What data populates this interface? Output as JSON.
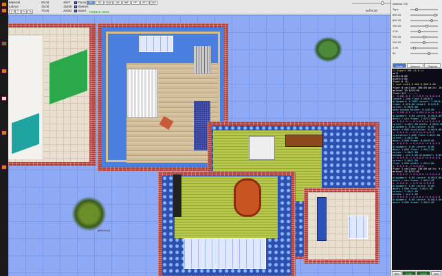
{
  "toolbar": {
    "row1": [
      {
        "k": "Material",
        "v": "55.00"
      },
      {
        "k": "",
        "v": "4607"
      }
    ],
    "row2": [
      {
        "k": "Labour",
        "v": "15.00"
      },
      {
        "k": "",
        "v": "15485"
      }
    ],
    "row3": [
      {
        "k": "Total",
        "v": "70.00"
      },
      {
        "k": "",
        "v": "20092"
      }
    ],
    "checkboxes": [
      "Floors",
      "Gleams",
      "Stand"
    ],
    "tool_tabs": [
      "2D",
      "3D",
      "SUB",
      "AB",
      "IBP",
      "PP",
      "JPT",
      "DXF"
    ],
    "green_status": "HB1916 US23",
    "left_buttons": [
      "0",
      "T",
      "Fx",
      "Ts",
      "Fd",
      "Ld",
      "Xs",
      "Fm"
    ],
    "right_readout": "self 8.00"
  },
  "right_panel": {
    "rows": [
      {
        "label": "Material",
        "value": "700"
      },
      {
        "label": "Type",
        "value": "",
        "pos": 0.2
      },
      {
        "label": "",
        "value": "800.00",
        "pos": 0.95
      },
      {
        "label": "",
        "value": "800.00",
        "pos": 0.8
      },
      {
        "label": "",
        "value": "100.00",
        "pos": 0.6
      },
      {
        "label": "",
        "value": "1.00",
        "pos": 0.3
      },
      {
        "label": "",
        "value": "200.00",
        "pos": 0.5
      },
      {
        "label": "",
        "value": "200.00",
        "pos": 0.5
      },
      {
        "label": "",
        "value": "2.00",
        "pos": 0.1
      },
      {
        "label": "",
        "value": "90",
        "pos": 0.7
      }
    ],
    "tabs": [
      "Code",
      "Artwork",
      "Objects"
    ],
    "console": [
      {
        "t": "== Export XML v4.0 ==",
        "c": "#ffe066"
      },
      {
        "t": "wall",
        "c": "#ffffff"
      },
      {
        "t": "width:0.00",
        "c": "#ffffff"
      },
      {
        "t": "width:2.00",
        "c": "#ffffff"
      },
      {
        "t": "floor 0 (1)",
        "c": "#ffffff"
      },
      {
        "t": "1 roof  width 0.000 0.000 0.00",
        "c": "#ffe066"
      },
      {
        "t": "floor 0 ceiling: 300.00  walls: 10.0/10",
        "c": "#ffffff"
      },
      {
        "t": "method: 20.0/20.00",
        "c": "#ffffff"
      },
      {
        "t": "floor:1/2 -------",
        "c": "#ffffff"
      },
      {
        "t": "  x: 0.041,0.0 -> 2,0.0 to 0.0,0.0",
        "c": "#ff7dff"
      },
      {
        "t": "  length 1.200  floor 0.00/0.0",
        "c": "#7df0ff"
      },
      {
        "t": "  alignment: 0.2807  corner: 1.00/0.00",
        "c": "#7df0ff"
      },
      {
        "t": "  frame: 0.0/0.00  height: 0.0/0.0",
        "c": "#7df0ff"
      },
      {
        "t": "  corner: 0.00/0.00",
        "c": "#7df0ff"
      },
      {
        "t": "  open  window  height: 0.0/0.00",
        "c": "#7df0ff"
      },
      {
        "t": "  x: 0.030,0.0 -> 0.030,0.0 to 0.0,0.0",
        "c": "#ff7dff"
      },
      {
        "t": "  alignment: 0.00  corner: 0.00/0.00",
        "c": "#7df0ff"
      },
      {
        "t": "  doors / win  frame: 1.02/1.000",
        "c": "#7df0ff"
      },
      {
        "t": "  x: 0.0,0.0 -> 0.0,0.0 to 0.0,0.0",
        "c": "#ff7dff"
      },
      {
        "t": "  corner: 1.00/1.00  width: 0.00/0.00",
        "c": "#7df0ff"
      },
      {
        "t": "  alignment: 0.00  corner: 0.00",
        "c": "#7df0ff"
      },
      {
        "t": "  doors 1.000  insulation: 0.00/0.00",
        "c": "#7df0ff"
      },
      {
        "t": "  x: 0.0,0.0 -> 0.0 to 0.0,0.0",
        "c": "#ff7dff"
      },
      {
        "t": "  insulation  1.000  floor  1.00/1.00",
        "c": "#7df0ff"
      },
      {
        "t": "  corner: 1.00/1.00",
        "c": "#7df0ff"
      },
      {
        "t": "  doors 1.000  frame: 0.00/0.00",
        "c": "#7df0ff"
      },
      {
        "t": "  x: 0.0,0.0 -> 0.0,0.0 to 0.0,0.0",
        "c": "#ff7dff"
      },
      {
        "t": "  alignment: 0.00  corner: 0.00",
        "c": "#7df0ff"
      },
      {
        "t": "  doors 1.000  floor: 1.00/1.00",
        "c": "#7df0ff"
      },
      {
        "t": "  corner: 1.00/1.00",
        "c": "#7df0ff"
      },
      {
        "t": "  window / win  0.00  alignment: 0.00",
        "c": "#7df0ff"
      },
      {
        "t": "  x: 0.0,0.0 -> 0.0,0.0 to 0.0,0.0",
        "c": "#ff7dff"
      },
      {
        "t": "  corner: 1.00/1.00",
        "c": "#7df0ff"
      },
      {
        "t": "  floor 1.000  width: 1.00/1.00",
        "c": "#7df0ff"
      },
      {
        "t": "  x: 0.0,0.0 -> 0.0,0.0",
        "c": "#ff7dff"
      },
      {
        "t": "floor 1 ceiling: 250.00  walls: 5.0/25",
        "c": "#ffffff"
      },
      {
        "t": "method: 25.0/25.00",
        "c": "#ffffff"
      },
      {
        "t": "  x: 0.0,0.0 -> 0.0,0.0 to 0.0,0.0",
        "c": "#ff7dff"
      },
      {
        "t": "  alignment: 0.00  corner: 0.00/0.00",
        "c": "#7df0ff"
      },
      {
        "t": "  doors / win  frame: 1.00/1.00",
        "c": "#7df0ff"
      },
      {
        "t": "  x: 0.0,0.0 -> 0.0 to 0.0,0.0",
        "c": "#ff7dff"
      },
      {
        "t": "  alignment: 0.00  corner: 0.00",
        "c": "#7df0ff"
      },
      {
        "t": "  doors 1.000  floor  1.00/1.00",
        "c": "#7df0ff"
      },
      {
        "t": "  corner: 1.00/1.00",
        "c": "#7df0ff"
      },
      {
        "t": "  window / win  0.00",
        "c": "#7df0ff"
      },
      {
        "t": "  x: 0.0,0.0 -> 0.0,0.0 to 0.0,0.0",
        "c": "#ff7dff"
      },
      {
        "t": "  alignment: 0.00  corner: 0.00/0.00",
        "c": "#7df0ff"
      },
      {
        "t": "  doors 1.000  frame: 1.00/1.00",
        "c": "#7df0ff"
      }
    ],
    "footer": [
      "New",
      "0.000",
      "0.000",
      "Save"
    ]
  },
  "watermark": "gHhh ltd (1)"
}
